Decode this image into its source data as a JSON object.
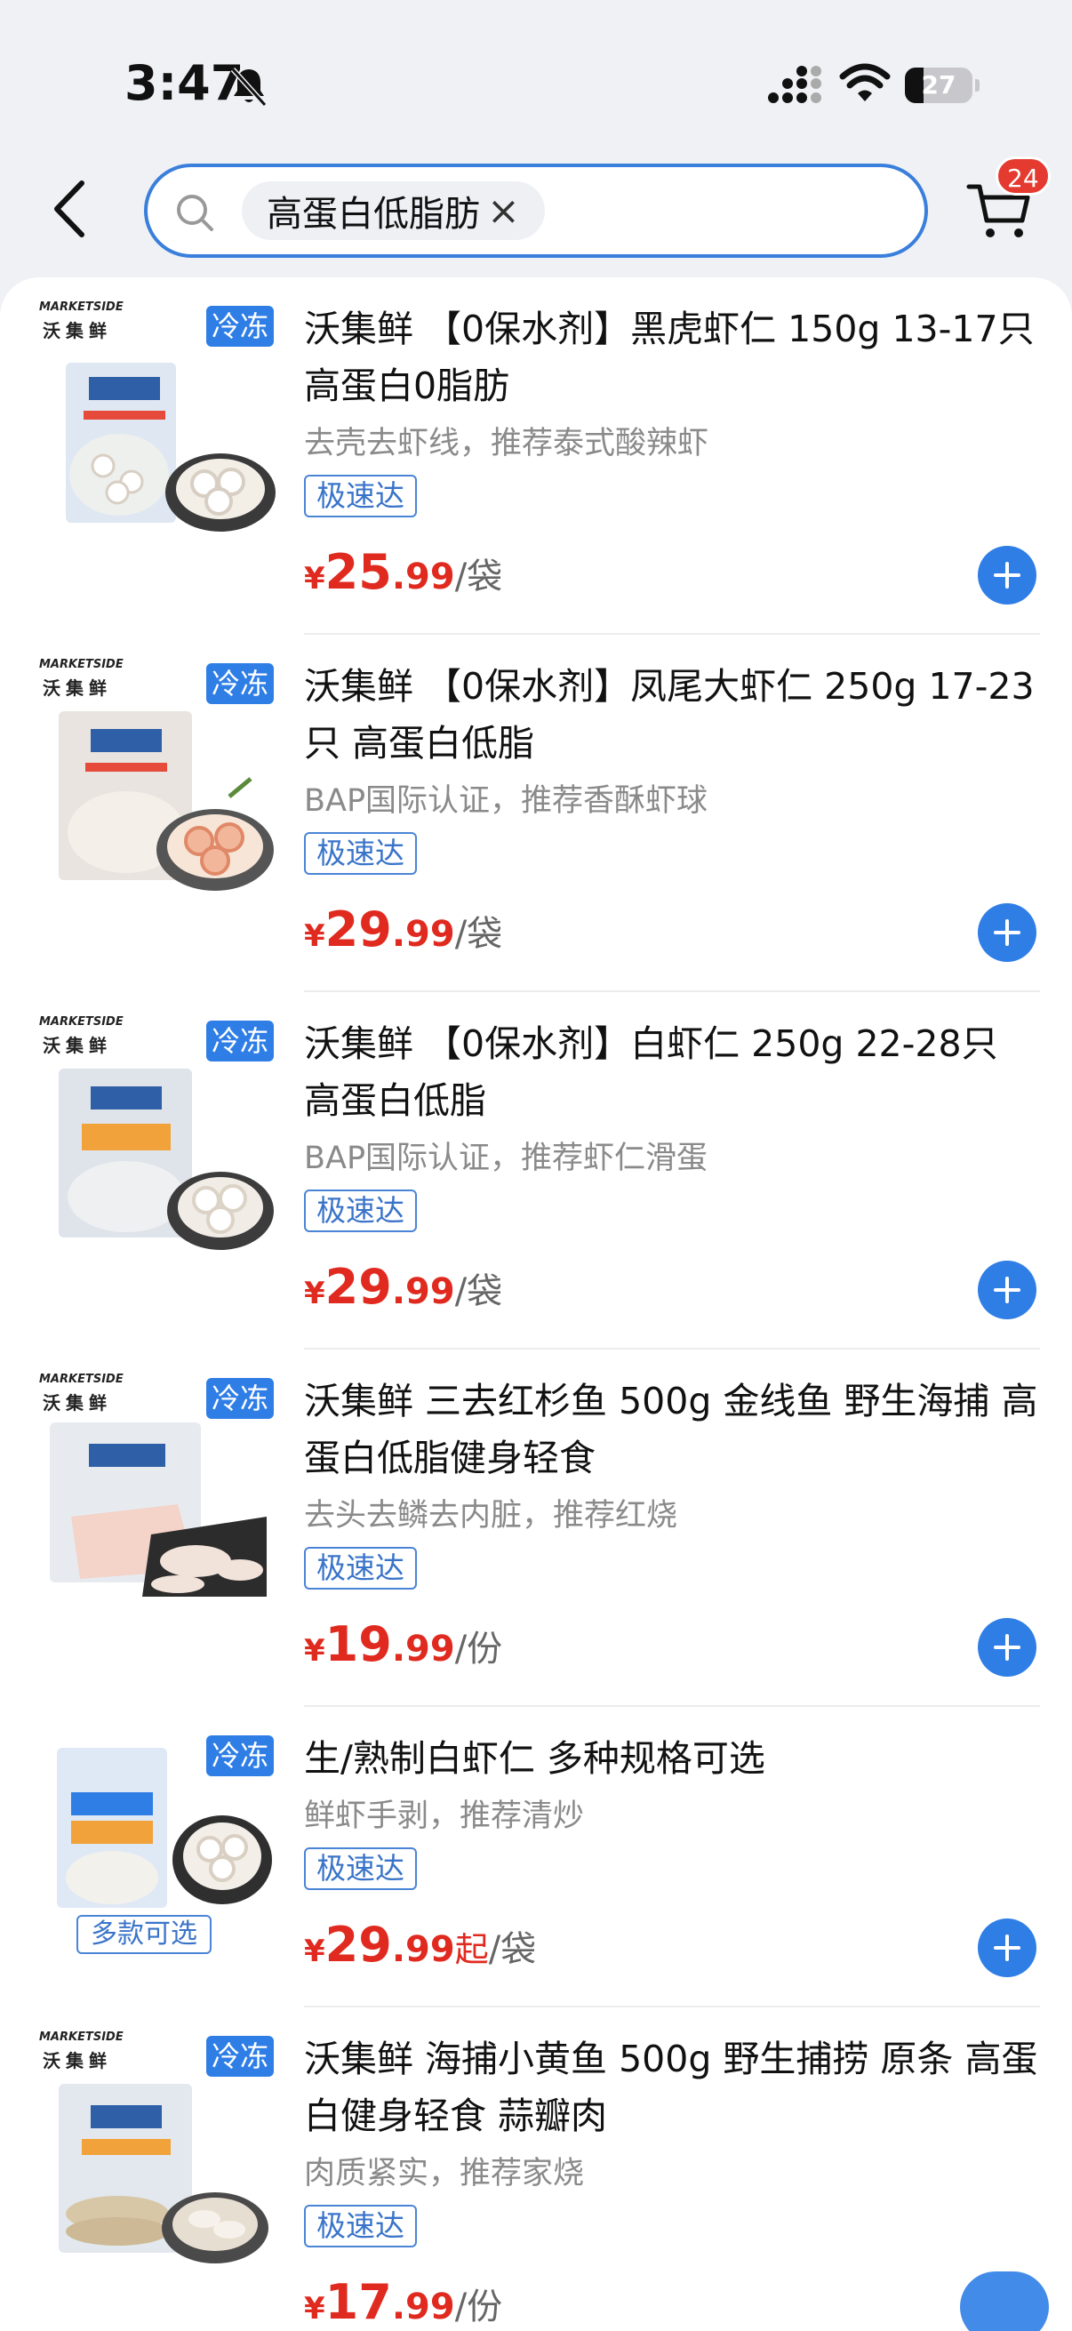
{
  "status": {
    "time": "3:47",
    "battery": "27"
  },
  "header": {
    "search_keyword": "高蛋白低脂肪",
    "clear_symbol": "×",
    "cart_count": "24"
  },
  "brand": {
    "en": "MARKETSIDE",
    "cn": "沃集鲜"
  },
  "products": [
    {
      "tag": "冷冻",
      "title": "沃集鲜 【0保水剂】黑虎虾仁 150g 13-17只 高蛋白0脂肪",
      "subtitle": "去壳去虾线，推荐泰式酸辣虾",
      "badge": "极速达",
      "currency": "¥",
      "price_int": "25",
      "price_dec": ".99",
      "price_suffix": "",
      "unit": "/袋"
    },
    {
      "tag": "冷冻",
      "title": "沃集鲜 【0保水剂】凤尾大虾仁 250g 17-23只  高蛋白低脂",
      "subtitle": "BAP国际认证，推荐香酥虾球",
      "badge": "极速达",
      "currency": "¥",
      "price_int": "29",
      "price_dec": ".99",
      "price_suffix": "",
      "unit": "/袋"
    },
    {
      "tag": "冷冻",
      "title": "沃集鲜 【0保水剂】白虾仁 250g  22-28只 高蛋白低脂",
      "subtitle": "BAP国际认证，推荐虾仁滑蛋",
      "badge": "极速达",
      "currency": "¥",
      "price_int": "29",
      "price_dec": ".99",
      "price_suffix": "",
      "unit": "/袋"
    },
    {
      "tag": "冷冻",
      "title": "沃集鲜 三去红杉鱼 500g  金线鱼 野生海捕 高蛋白低脂健身轻食",
      "subtitle": "去头去鳞去内脏，推荐红烧",
      "badge": "极速达",
      "currency": "¥",
      "price_int": "19",
      "price_dec": ".99",
      "price_suffix": "",
      "unit": "/份"
    },
    {
      "tag": "冷冻",
      "title": "生/熟制白虾仁 多种规格可选",
      "subtitle": "鲜虾手剥，推荐清炒",
      "badge": "极速达",
      "currency": "¥",
      "price_int": "29",
      "price_dec": ".99",
      "price_suffix": "起",
      "unit": "/袋",
      "multi_label": "多款可选"
    },
    {
      "tag": "冷冻",
      "title": "沃集鲜 海捕小黄鱼 500g 野生捕捞 原条 高蛋白健身轻食 蒜瓣肉",
      "subtitle": "肉质紧实，推荐家烧",
      "badge": "极速达",
      "currency": "¥",
      "price_int": "17",
      "price_dec": ".99",
      "price_suffix": "",
      "unit": "/份"
    }
  ]
}
